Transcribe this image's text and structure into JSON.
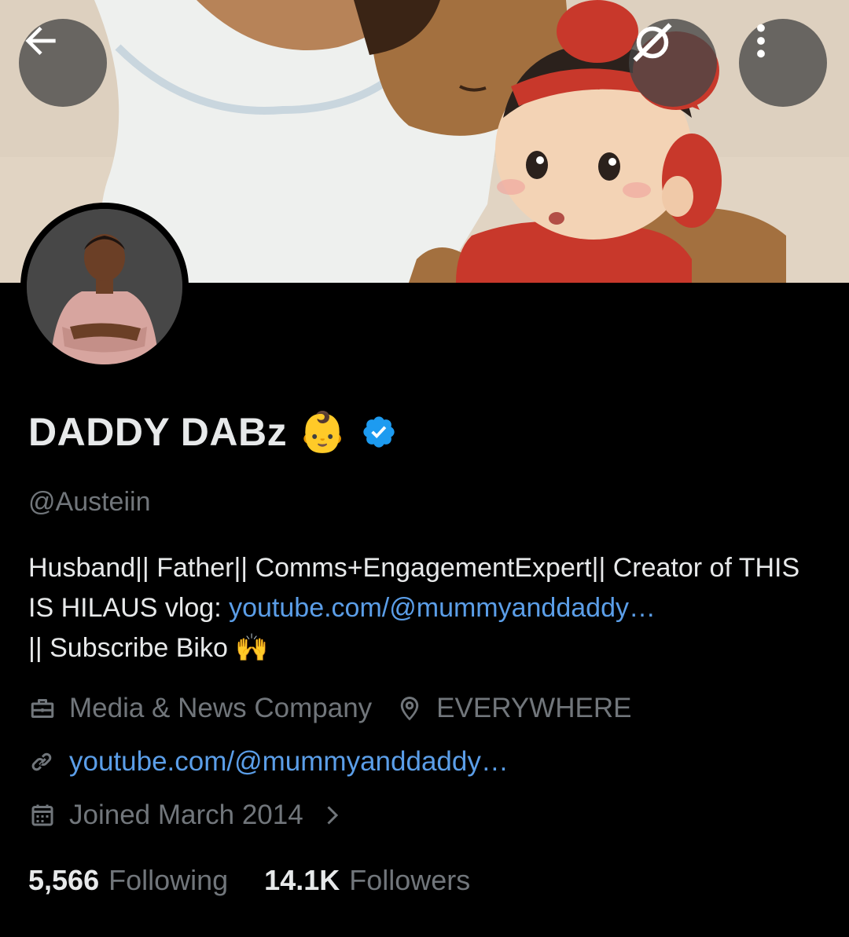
{
  "header": {
    "back_icon": "arrow-left-icon",
    "explore_icon": "grok-explore-icon",
    "more_icon": "more-vertical-icon"
  },
  "profile": {
    "display_name": "DADDY DABz",
    "name_emoji": "👶",
    "verified": true,
    "handle": "@Austeiin",
    "bio_part1": "Husband|| Father|| Comms+EngagementExpert|| Creator of THIS IS HILAUS vlog: ",
    "bio_link": "youtube.com/@mummyanddaddy…",
    "bio_part2": "|| Subscribe Biko ",
    "bio_emoji": "🙌",
    "category": "Media & News Company",
    "location": "EVERYWHERE",
    "website": "youtube.com/@mummyanddaddy…",
    "joined": "Joined March 2014"
  },
  "stats": {
    "following_count": "5,566",
    "following_label": "Following",
    "followers_count": "14.1K",
    "followers_label": "Followers"
  },
  "colors": {
    "background": "#000000",
    "primary_text": "#e7e9ea",
    "secondary_text": "#71767b",
    "link": "#5b9ee8",
    "verified_badge": "#1d9bf0"
  }
}
